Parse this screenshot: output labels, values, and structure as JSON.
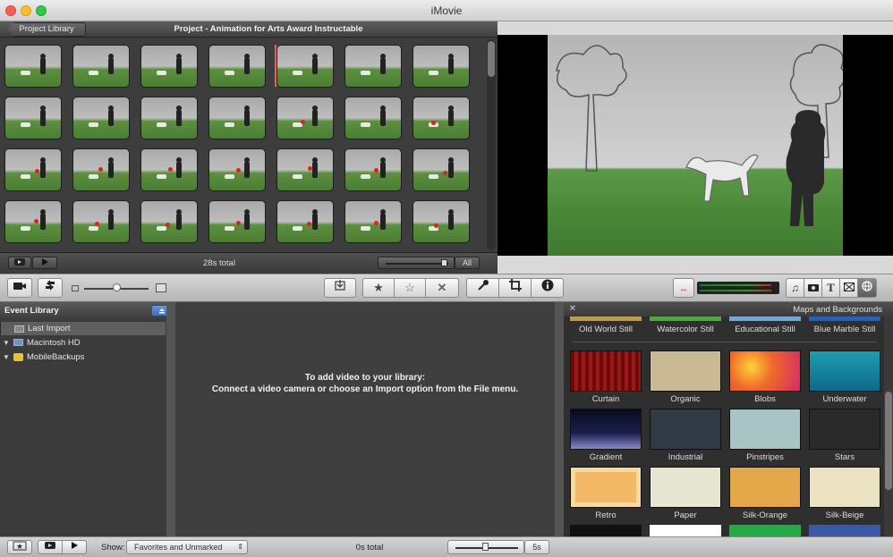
{
  "window": {
    "title": "iMovie"
  },
  "project": {
    "library_button": "Project Library",
    "title": "Project - Animation for Arts Award Instructable",
    "total": "28s total",
    "zoom_label": "All"
  },
  "toolbar": {
    "icons": [
      "camera",
      "swap",
      "thumb-size-small",
      "thumb-size-large",
      "import",
      "favorite-star",
      "unfavorite-star",
      "reject-x",
      "keyword",
      "crop",
      "info",
      "audio-adjust",
      "music",
      "photo",
      "title",
      "transition",
      "maps"
    ]
  },
  "event_library": {
    "title": "Event Library",
    "items": [
      {
        "label": "Last Import"
      },
      {
        "label": "Macintosh HD"
      },
      {
        "label": "MobileBackups"
      }
    ]
  },
  "events_browser": {
    "empty_line1": "To add video to your library:",
    "empty_line2": "Connect a video camera or choose an Import option from the File menu."
  },
  "maps_panel": {
    "title": "Maps and Backgrounds",
    "top_row": [
      "Old World Still",
      "Watercolor Still",
      "Educational Still",
      "Blue Marble Still"
    ],
    "tiles": [
      {
        "label": "Curtain",
        "color": "#7a0d0d"
      },
      {
        "label": "Organic",
        "color": "#c9b994"
      },
      {
        "label": "Blobs",
        "color": "#f06a28"
      },
      {
        "label": "Underwater",
        "color": "#1e9db0"
      },
      {
        "label": "Gradient",
        "color": "#1a1f4a"
      },
      {
        "label": "Industrial",
        "color": "#2f3a44"
      },
      {
        "label": "Pinstripes",
        "color": "#a9c4c4"
      },
      {
        "label": "Stars",
        "color": "#2a2a2a"
      },
      {
        "label": "Retro",
        "color": "#f2b866"
      },
      {
        "label": "Paper",
        "color": "#e6e6d2"
      },
      {
        "label": "Silk-Orange",
        "color": "#e3a84a"
      },
      {
        "label": "Silk-Beige",
        "color": "#ebe2c2"
      }
    ]
  },
  "bottom": {
    "show_label": "Show:",
    "show_value": "Favorites and Unmarked",
    "total": "0s total",
    "zoom_value": "5s"
  }
}
